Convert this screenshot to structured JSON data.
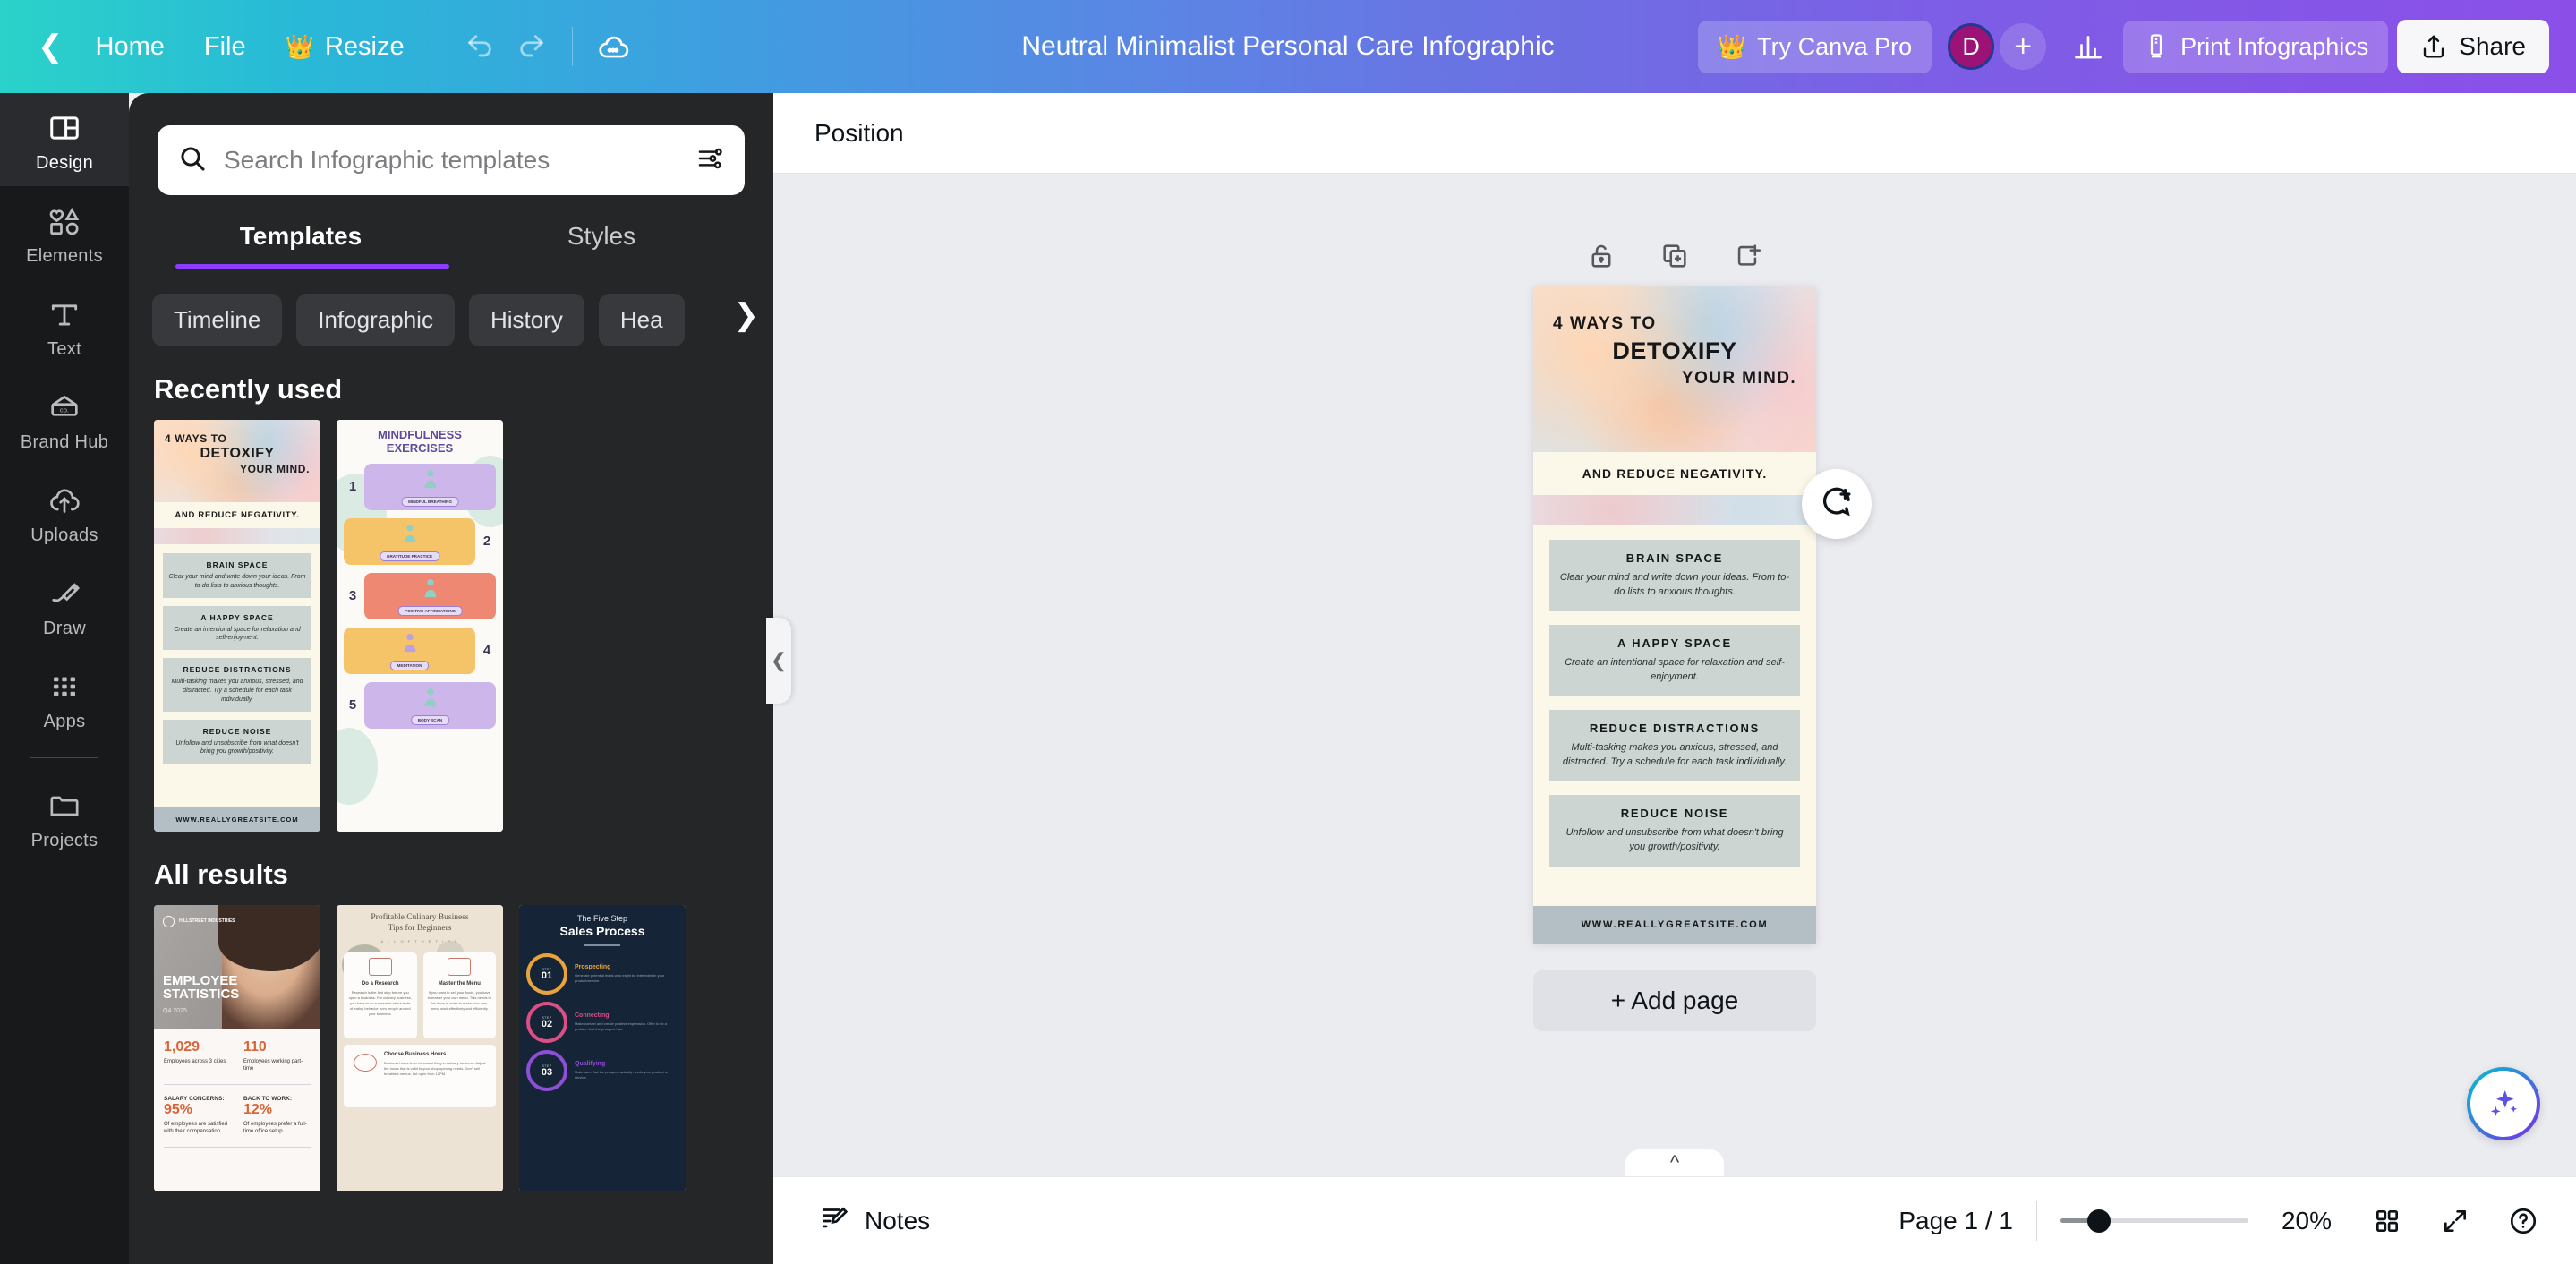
{
  "header": {
    "back_icon": "chevron-left-icon",
    "home_label": "Home",
    "file_label": "File",
    "resize_label": "Resize",
    "resize_icon": "crown-icon",
    "undo_icon": "undo-icon",
    "redo_icon": "redo-icon",
    "cloud_icon": "cloud-saving-icon",
    "title": "Neutral Minimalist Personal Care Infographic",
    "try_pro_label": "Try Canva Pro",
    "try_pro_icon": "crown-icon",
    "avatar_initial": "D",
    "add_collaborator_icon": "plus-icon",
    "insights_icon": "bar-chart-icon",
    "print_icon": "print-product-icon",
    "print_label": "Print Infographics",
    "share_label": "Share",
    "share_icon": "share-upload-icon"
  },
  "rail": {
    "items": [
      {
        "label": "Design",
        "icon": "layout-panels-icon",
        "active": true
      },
      {
        "label": "Elements",
        "icon": "shapes-icon",
        "active": false
      },
      {
        "label": "Text",
        "icon": "text-t-icon",
        "active": false
      },
      {
        "label": "Brand Hub",
        "icon": "brand-tag-icon",
        "active": false
      },
      {
        "label": "Uploads",
        "icon": "cloud-upload-icon",
        "active": false
      },
      {
        "label": "Draw",
        "icon": "pen-draw-icon",
        "active": false
      },
      {
        "label": "Apps",
        "icon": "apps-grid-icon",
        "active": false
      },
      {
        "label": "Projects",
        "icon": "folder-icon",
        "active": false
      }
    ]
  },
  "panel": {
    "search_placeholder": "Search Infographic templates",
    "search_value": "",
    "search_icon": "search-icon",
    "filter_icon": "sliders-filter-icon",
    "tabs": [
      {
        "label": "Templates",
        "active": true
      },
      {
        "label": "Styles",
        "active": false
      }
    ],
    "chips": [
      "Timeline",
      "Infographic",
      "History",
      "Hea"
    ],
    "chip_next_icon": "chevron-right-icon",
    "recently_used_title": "Recently used",
    "all_results_title": "All results"
  },
  "collapse_handle_icon": "collapse-panel-icon",
  "position_bar": {
    "position_label": "Position"
  },
  "page_tools": [
    {
      "icon": "lock-open-icon",
      "name": "lock-page-button"
    },
    {
      "icon": "duplicate-page-icon",
      "name": "duplicate-page-button"
    },
    {
      "icon": "add-page-icon",
      "name": "add-page-button"
    }
  ],
  "comment_fab_icon": "add-comment-icon",
  "ai_fab_icon": "magic-sparkle-icon",
  "add_page_label": "+ Add page",
  "scroll_caret_icon": "chevron-up-icon",
  "document": {
    "title_line1": "4 WAYS TO",
    "title_line2": "DETOXIFY",
    "title_line3": "YOUR MIND.",
    "subtitle": "AND REDUCE NEGATIVITY.",
    "blocks": [
      {
        "heading": "BRAIN SPACE",
        "body": "Clear your mind and write down your ideas. From to-do lists to anxious thoughts."
      },
      {
        "heading": "A HAPPY SPACE",
        "body": "Create an intentional space for relaxation and self-enjoyment."
      },
      {
        "heading": "REDUCE DISTRACTIONS",
        "body": "Multi-tasking makes you anxious, stressed, and distracted. Try a schedule for each task individually."
      },
      {
        "heading": "REDUCE NOISE",
        "body": "Unfollow and unsubscribe from what doesn't bring you growth/positivity."
      }
    ],
    "footer": "WWW.REALLYGREATSITE.COM"
  },
  "thumbnails": {
    "recently_used": [
      {
        "name": "detoxify-your-mind-template",
        "title_line1": "4 WAYS TO",
        "title_line2": "DETOXIFY",
        "title_line3": "YOUR MIND.",
        "subtitle": "AND REDUCE NEGATIVITY.",
        "blocks": [
          {
            "heading": "BRAIN SPACE",
            "body": "Clear your mind and write down your ideas. From to-do lists to anxious thoughts."
          },
          {
            "heading": "A HAPPY SPACE",
            "body": "Create an intentional space for relaxation and self-enjoyment."
          },
          {
            "heading": "REDUCE DISTRACTIONS",
            "body": "Multi-tasking makes you anxious, stressed, and distracted. Try a schedule for each task individually."
          },
          {
            "heading": "REDUCE NOISE",
            "body": "Unfollow and unsubscribe from what doesn't bring you growth/positivity."
          }
        ],
        "footer": "WWW.REALLYGREATSITE.COM"
      },
      {
        "name": "mindfulness-exercises-template",
        "title_line1": "MINDFULNESS",
        "title_line2": "EXERCISES",
        "steps": [
          {
            "number": "1",
            "tag": "MINDFUL BREATHING",
            "color": "#cdb6ea"
          },
          {
            "number": "2",
            "tag": "GRATITUDE PRACTICE",
            "color": "#f6c468"
          },
          {
            "number": "3",
            "tag": "POSITIVE AFFIRMATIONS",
            "color": "#ef8872"
          },
          {
            "number": "4",
            "tag": "MEDITATION",
            "color": "#f6c468"
          },
          {
            "number": "5",
            "tag": "BODY SCAN",
            "color": "#cdb6ea"
          }
        ]
      }
    ],
    "all_results": [
      {
        "name": "employee-statistics-template",
        "brand": "HILLSTREET INDUSTRIES",
        "title_line1": "EMPLOYEE",
        "title_line2": "STATISTICS",
        "quarter": "Q4 2025",
        "stats": [
          {
            "value": "1,029",
            "label": "Employees across 3 cities"
          },
          {
            "value": "110",
            "label": "Employees working part-time"
          }
        ],
        "stats2": [
          {
            "label": "SALARY CONCERNS:",
            "value": "95%",
            "desc": "Of employees are satisfied with their compensation"
          },
          {
            "label": "BACK TO WORK:",
            "value": "12%",
            "desc": "Of employees prefer a full-time office setup"
          }
        ]
      },
      {
        "name": "culinary-business-tips-template",
        "title_line1": "Profitable Culinary Business",
        "title_line2": "Tips for Beginners",
        "subtitle": "A L L  O F  T H E  T I P S",
        "cards": [
          {
            "heading": "Do a Research",
            "body": "Research is the first step before you open a business. For culinary business, you have to do a research about taste of eating behavior from people around your business."
          },
          {
            "heading": "Master the Menu",
            "body": "If you want to sell your foods, you have to master your own menu. This needs to be done in order to make your own menu work effectively and efficiently."
          },
          {
            "heading": "Choose Business Hours",
            "body": "Business hours is an important thing in culinary business. Adjust the hours that is valid to your shop opening needs. Don't sell breakfast menus, but open from 12PM."
          }
        ]
      },
      {
        "name": "five-step-sales-process-template",
        "title_line1": "The Five Step",
        "title_line2": "Sales Process",
        "steps": [
          {
            "step_label": "STEP",
            "number": "01",
            "heading": "Prospecting",
            "body": "Generate potential leads who might be interested in your product/service.",
            "color": "#e8a33d"
          },
          {
            "step_label": "STEP",
            "number": "02",
            "heading": "Connecting",
            "body": "Make contact and create positive impression. Offer to fix a problem that the prospect has.",
            "color": "#d94f86"
          },
          {
            "step_label": "STEP",
            "number": "03",
            "heading": "Qualifying",
            "body": "Make sure that the prospect actually needs your product or service.",
            "color": "#8d4fd4"
          }
        ]
      }
    ]
  },
  "bottom_bar": {
    "notes_label": "Notes",
    "notes_icon": "notes-pencil-icon",
    "page_indicator": "Page 1 / 1",
    "zoom_value": "20%",
    "grid_view_icon": "grid-view-icon",
    "fullscreen_icon": "fullscreen-expand-icon",
    "help_icon": "help-question-icon"
  },
  "colors": {
    "accent_purple": "#8b3dff",
    "panel_bg": "#252627",
    "rail_bg": "#18191b",
    "canvas_bg": "#ebecf0"
  }
}
